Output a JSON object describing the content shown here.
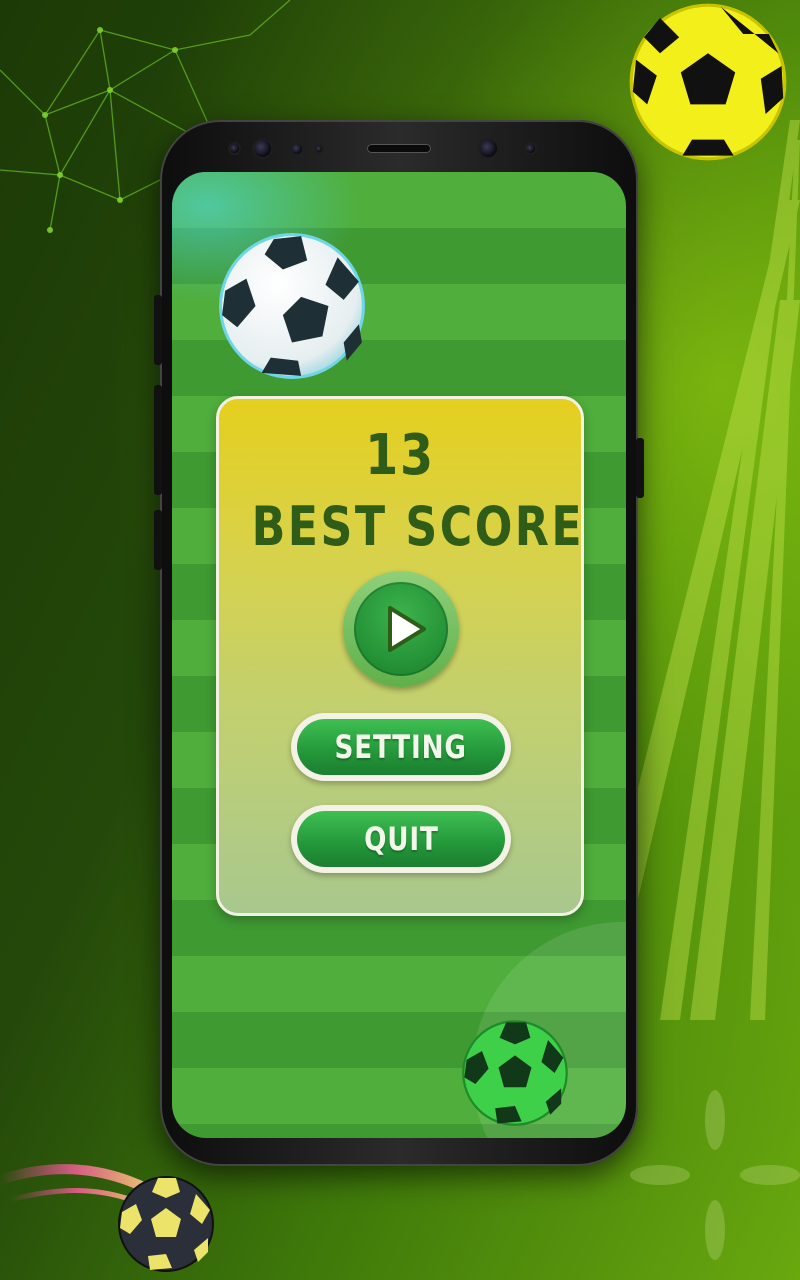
{
  "game": {
    "score": "13",
    "best_score_label": "BEST SCORE",
    "buttons": {
      "play_icon": "play-icon",
      "setting_label": "SETTING",
      "quit_label": "QUIT"
    }
  },
  "colors": {
    "background_dark": "#1c3a06",
    "background_light": "#6aa80f",
    "field_stripe_a": "#4fae3c",
    "field_stripe_b": "#3f9a32",
    "panel_top": "#e5cf1f",
    "panel_text": "#2f5d17",
    "button_green": "#23973a",
    "button_border": "#f4f1e6"
  },
  "icons": {
    "decorative_balls": [
      "soccer-ball-icon-white",
      "soccer-ball-icon-green",
      "soccer-ball-icon-yellow",
      "soccer-ball-icon-dark"
    ]
  }
}
